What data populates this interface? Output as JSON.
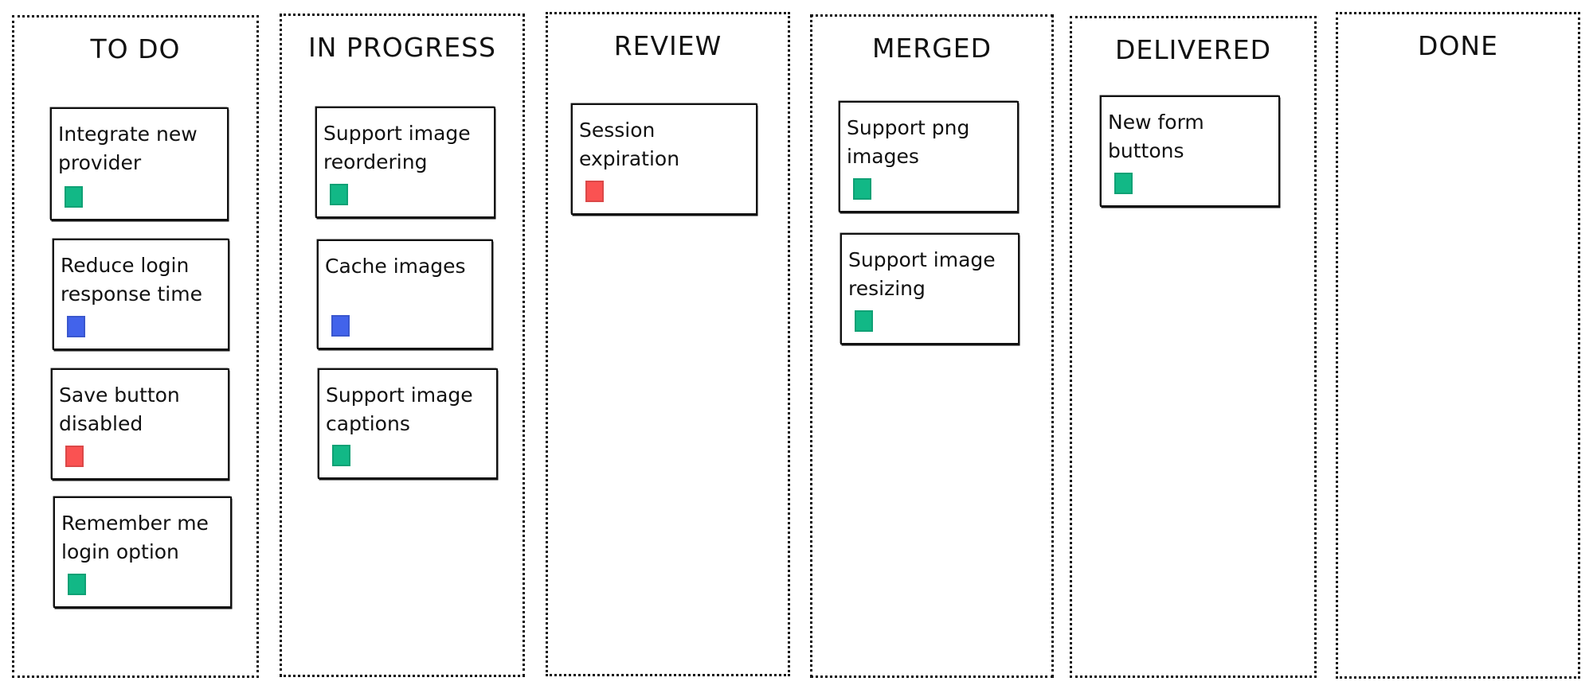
{
  "board": {
    "colors": {
      "green": "#12b886",
      "blue": "#4263eb",
      "red": "#fa5252"
    },
    "columns": [
      {
        "title": "TO DO",
        "cards": [
          {
            "title": "Integrate new provider",
            "tag": "green"
          },
          {
            "title": "Reduce login response time",
            "tag": "blue"
          },
          {
            "title": "Save button disabled",
            "tag": "red"
          },
          {
            "title": "Remember me login option",
            "tag": "green"
          }
        ]
      },
      {
        "title": "IN PROGRESS",
        "cards": [
          {
            "title": "Support image reordering",
            "tag": "green"
          },
          {
            "title": "Cache images",
            "tag": "blue"
          },
          {
            "title": "Support image captions",
            "tag": "green"
          }
        ]
      },
      {
        "title": "REVIEW",
        "cards": [
          {
            "title": "Session expiration",
            "tag": "red"
          }
        ]
      },
      {
        "title": "MERGED",
        "cards": [
          {
            "title": "Support png images",
            "tag": "green"
          },
          {
            "title": "Support image resizing",
            "tag": "green"
          }
        ]
      },
      {
        "title": "DELIVERED",
        "cards": [
          {
            "title": "New form buttons",
            "tag": "green"
          }
        ]
      },
      {
        "title": "DONE",
        "cards": []
      }
    ]
  }
}
